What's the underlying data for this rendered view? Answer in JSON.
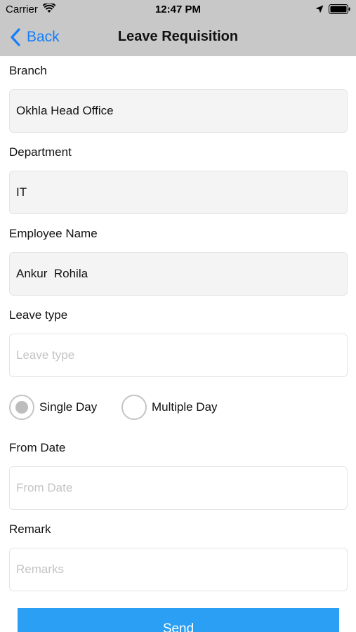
{
  "status_bar": {
    "carrier": "Carrier",
    "time": "12:47 PM"
  },
  "nav": {
    "back_label": "Back",
    "title": "Leave Requisition"
  },
  "form": {
    "branch": {
      "label": "Branch",
      "value": "Okhla Head Office"
    },
    "department": {
      "label": "Department",
      "value": "IT"
    },
    "employee_name": {
      "label": "Employee Name",
      "value": "Ankur  Rohila"
    },
    "leave_type": {
      "label": "Leave type",
      "value": "",
      "placeholder": "Leave type"
    },
    "day_options": [
      {
        "label": "Single Day",
        "checked": true
      },
      {
        "label": "Multiple Day",
        "checked": false
      }
    ],
    "from_date": {
      "label": "From Date",
      "value": "",
      "placeholder": "From Date"
    },
    "remark": {
      "label": "Remark",
      "value": "",
      "placeholder": "Remarks"
    }
  },
  "send_label": "Send",
  "colors": {
    "bar_bg": "#c8c8c8",
    "accent": "#157efb",
    "button": "#2b9ff3",
    "placeholder": "#c4c4c4"
  }
}
